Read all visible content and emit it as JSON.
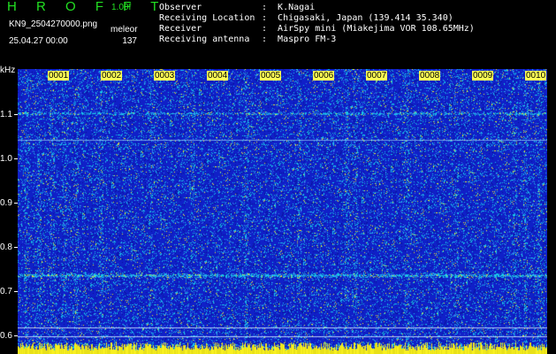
{
  "header": {
    "app_title": "H R O F F T",
    "version": "1.00f",
    "filename": "KN9_2504270000.png",
    "detector": "meleor",
    "datetime": "25.04.27 00:00",
    "count": "137"
  },
  "meta": [
    {
      "label": "Observer",
      "value": ":  K.Nagai"
    },
    {
      "label": "Receiving Location",
      "value": ":  Chigasaki, Japan (139.414 35.340)"
    },
    {
      "label": "Receiver",
      "value": ":  AirSpy mini (Miakejima VOR 108.65MHz)"
    },
    {
      "label": "Receiving antenna",
      "value": ":  Maspro FM-3"
    }
  ],
  "axis": {
    "unit": "kHz",
    "y_ticks": [
      "1.1",
      "1.0",
      "0.9",
      "0.8",
      "0.7",
      "0.6"
    ],
    "x_ticks": [
      "0001",
      "0002",
      "0003",
      "0004",
      "0005",
      "0006",
      "0007",
      "0008",
      "0009",
      "0010"
    ]
  },
  "colors": {
    "background_blue": "#1020c8",
    "noise_cyan": "#18c8e8",
    "signal_yellow": "#f8f020",
    "header_green": "#22e022"
  }
}
